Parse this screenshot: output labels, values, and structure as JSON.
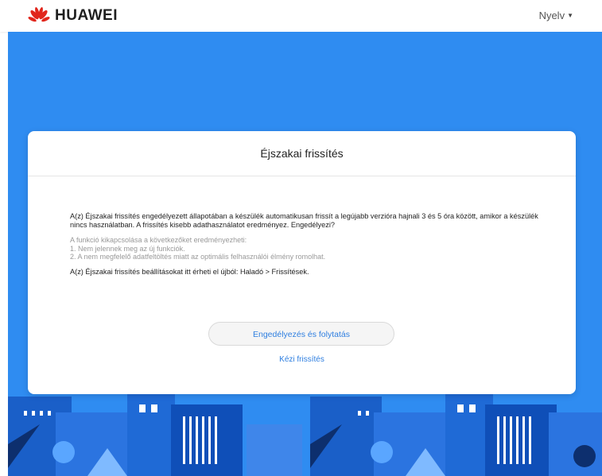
{
  "header": {
    "brand": "HUAWEI",
    "language_label": "Nyelv"
  },
  "dialog": {
    "title": "Éjszakai frissítés",
    "main_text": "A(z) Éjszakai frissítés engedélyezett állapotában a készülék automatikusan frissít a legújabb verzióra hajnali 3 és 5 óra között, amikor a készülék nincs használatban. A frissítés kisebb adathasználatot eredményez. Engedélyezi?",
    "hint_lines": [
      "A funkció kikapcsolása a következőket eredményezheti:",
      "1. Nem jelennek meg az új funkciók.",
      "2. A nem megfelelő adatfeltöltés miatt az optimális felhasználói élmény romolhat."
    ],
    "path_text": "A(z) Éjszakai frissítés beállításokat itt érheti el újból: Haladó > Frissítések.",
    "primary_button": "Engedélyezés és folytatás",
    "secondary_link": "Kézi frissítés"
  },
  "colors": {
    "background_blue": "#2f8cf1",
    "link_blue": "#2f7fe0",
    "brand_red": "#e1251b"
  },
  "icons": {
    "logo": "huawei-petal-logo",
    "caret": "caret-down-icon"
  }
}
